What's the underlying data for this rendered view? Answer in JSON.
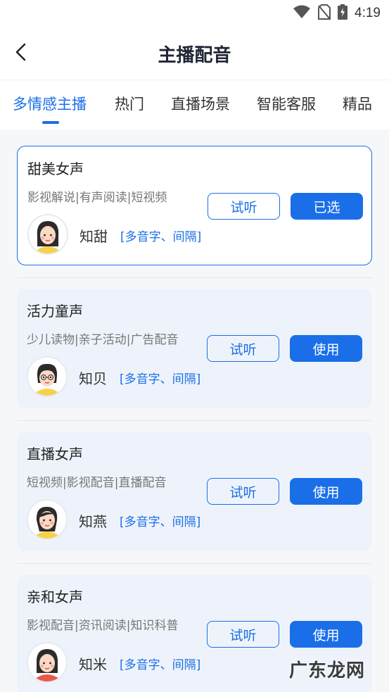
{
  "status_bar": {
    "time": "4:19",
    "icons": [
      "wifi-icon",
      "no-sim-icon",
      "battery-charging-icon"
    ]
  },
  "header": {
    "title": "主播配音",
    "back_icon": "back-arrow-icon"
  },
  "tabs": [
    {
      "label": "多情感主播",
      "active": true
    },
    {
      "label": "热门",
      "active": false
    },
    {
      "label": "直播场景",
      "active": false
    },
    {
      "label": "智能客服",
      "active": false
    },
    {
      "label": "精品",
      "active": false
    }
  ],
  "cards": [
    {
      "title": "甜美女声",
      "tags": "影视解说|有声阅读|短视频",
      "voice_name": "知甜",
      "feature": "[多音字、间隔]",
      "listen_label": "试听",
      "action_label": "已选",
      "selected": true
    },
    {
      "title": "活力童声",
      "tags": "少儿读物|亲子活动|广告配音",
      "voice_name": "知贝",
      "feature": "[多音字、间隔]",
      "listen_label": "试听",
      "action_label": "使用",
      "selected": false
    },
    {
      "title": "直播女声",
      "tags": "短视频|影视配音|直播配音",
      "voice_name": "知燕",
      "feature": "[多音字、间隔]",
      "listen_label": "试听",
      "action_label": "使用",
      "selected": false
    },
    {
      "title": "亲和女声",
      "tags": "影视配音|资讯阅读|知识科普",
      "voice_name": "知米",
      "feature": "[多音字、间隔]",
      "listen_label": "试听",
      "action_label": "使用",
      "selected": false
    }
  ],
  "watermark": "广东龙网",
  "colors": {
    "accent": "#1a6fe8",
    "card_bg": "#eef3fb",
    "page_bg": "#f6f7f9"
  }
}
